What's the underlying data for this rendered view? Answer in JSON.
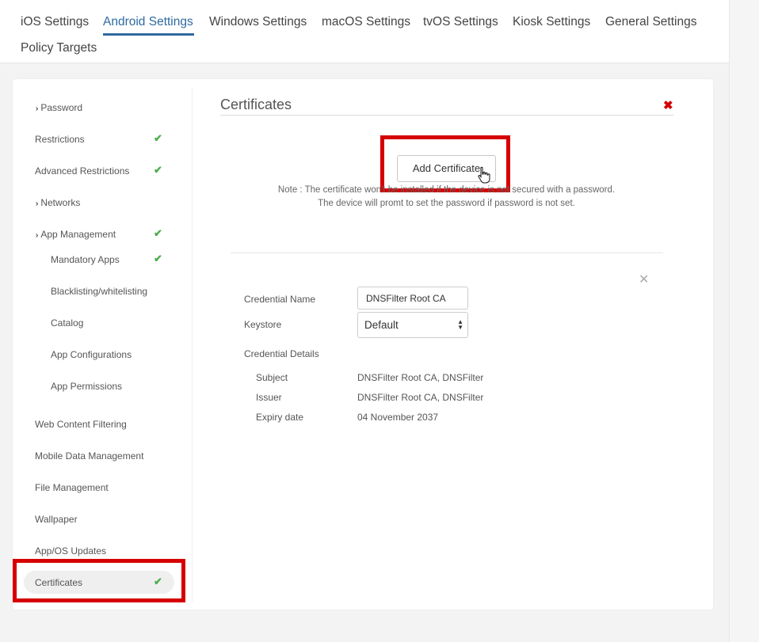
{
  "tabs": [
    {
      "label": "iOS Settings",
      "active": false
    },
    {
      "label": "Android Settings",
      "active": true
    },
    {
      "label": "Windows Settings",
      "active": false
    },
    {
      "label": "macOS Settings",
      "active": false
    },
    {
      "label": "tvOS Settings",
      "active": false
    },
    {
      "label": "Kiosk Settings",
      "active": false
    },
    {
      "label": "General Settings",
      "active": false
    },
    {
      "label": "Policy Targets",
      "active": false
    }
  ],
  "sidebar": {
    "items": [
      {
        "label": "Password",
        "expandable": true,
        "checked": false
      },
      {
        "label": "Restrictions",
        "expandable": false,
        "checked": true
      },
      {
        "label": "Advanced Restrictions",
        "expandable": false,
        "checked": true
      },
      {
        "label": "Networks",
        "expandable": true,
        "checked": false
      },
      {
        "label": "App Management",
        "expandable": true,
        "checked": true
      },
      {
        "label": "Mandatory Apps",
        "sub": true,
        "checked": true
      },
      {
        "label": "Blacklisting/whitelisting",
        "sub": true,
        "checked": false
      },
      {
        "label": "Catalog",
        "sub": true,
        "checked": false
      },
      {
        "label": "App Configurations",
        "sub": true,
        "checked": false
      },
      {
        "label": "App Permissions",
        "sub": true,
        "checked": false
      },
      {
        "label": "Web Content Filtering",
        "checked": false
      },
      {
        "label": "Mobile Data Management",
        "checked": false
      },
      {
        "label": "File Management",
        "checked": false
      },
      {
        "label": "Wallpaper",
        "checked": false
      },
      {
        "label": "App/OS Updates",
        "checked": false
      },
      {
        "label": "Certificates",
        "checked": true,
        "selected": true
      }
    ]
  },
  "section": {
    "title": "Certificates",
    "add_button": "Add Certificate",
    "note_line1": "Note : The certificate won't be installed if the device is not secured with a password.",
    "note_line2": "The device will promt to set the password if password is not set."
  },
  "form": {
    "credential_name_label": "Credential Name",
    "credential_name_value": "DNSFilter Root CA",
    "keystore_label": "Keystore",
    "keystore_value": "Default",
    "credential_details_label": "Credential Details",
    "subject_label": "Subject",
    "subject_value": "DNSFilter Root CA, DNSFilter",
    "issuer_label": "Issuer",
    "issuer_value": "DNSFilter Root CA, DNSFilter",
    "expiry_label": "Expiry date",
    "expiry_value": "04 November 2037"
  },
  "colors": {
    "accent": "#2f6aa0",
    "highlight": "#d60000",
    "check": "#4cae4c"
  }
}
